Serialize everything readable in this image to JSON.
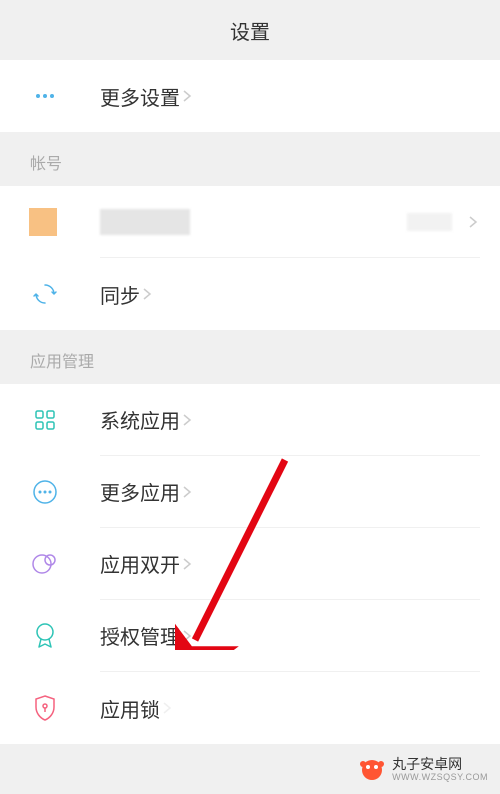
{
  "header": {
    "title": "设置"
  },
  "sections": {
    "top": {
      "more_settings": "更多设置"
    },
    "account": {
      "header": "帐号",
      "sync": "同步"
    },
    "app_management": {
      "header": "应用管理",
      "system_apps": "系统应用",
      "more_apps": "更多应用",
      "dual_apps": "应用双开",
      "permission_management": "授权管理",
      "app_lock": "应用锁"
    }
  },
  "watermark": {
    "title": "丸子安卓网",
    "url": "WWW.WZSQSY.COM"
  }
}
